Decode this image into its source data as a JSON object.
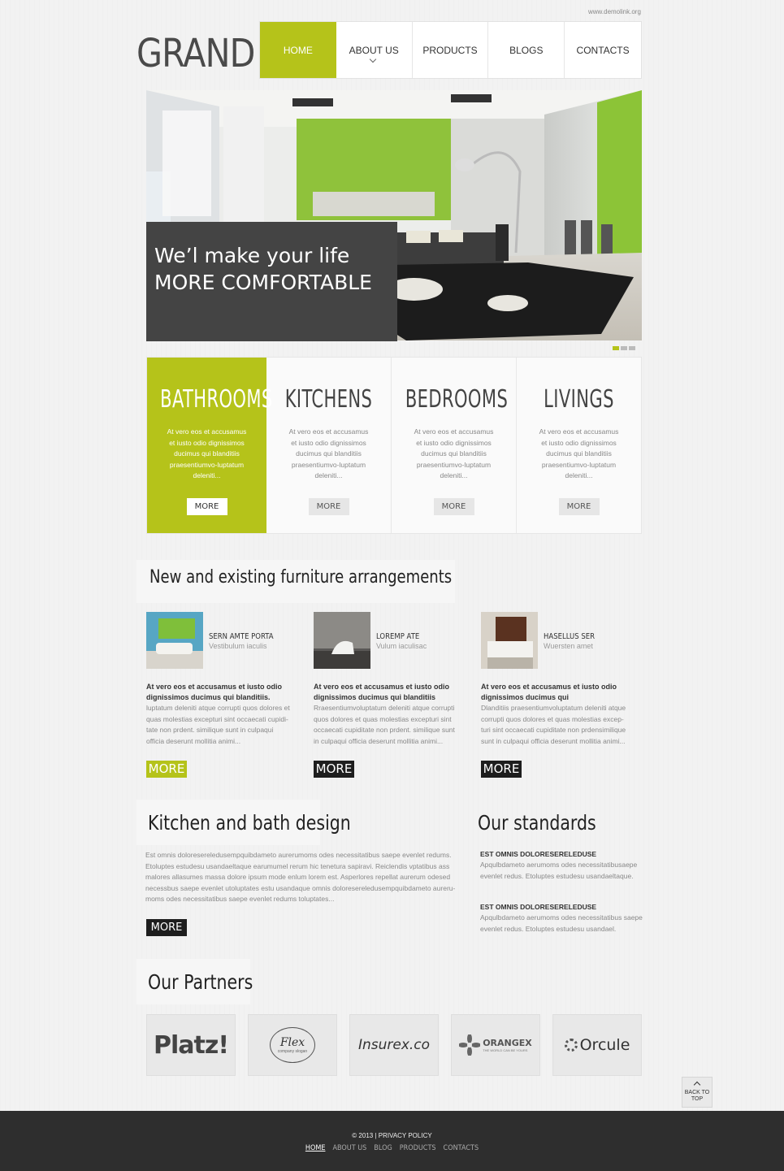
{
  "header": {
    "demo_link": "www.demolink.org",
    "logo": "GRAND",
    "nav": [
      "HOME",
      "ABOUT US",
      "PRODUCTS",
      "BLOGS",
      "CONTACTS"
    ]
  },
  "hero": {
    "line1": "We’l make your life",
    "line2": "MORE COMFORTABLE",
    "slides_total": 3,
    "slide_active": 1
  },
  "categories": [
    {
      "title": "BATHROOMS",
      "text": "At vero eos et accusamus et iusto odio dignissimos ducimus qui blanditiis praesentiumvo-luptatum deleniti...",
      "more": "MORE"
    },
    {
      "title": "KITCHENS",
      "text": "At vero eos et accusamus et iusto odio dignissimos ducimus qui blanditiis praesentiumvo-luptatum deleniti...",
      "more": "MORE"
    },
    {
      "title": "BEDROOMS",
      "text": "At vero eos et accusamus et iusto odio dignissimos ducimus qui blanditiis praesentiumvo-luptatum deleniti...",
      "more": "MORE"
    },
    {
      "title": "LIVINGS",
      "text": "At vero eos et accusamus et iusto odio dignissimos ducimus qui blanditiis praesentiumvo-luptatum deleniti...",
      "more": "MORE"
    }
  ],
  "arrangements": {
    "title": "New and existing furniture arrangements",
    "items": [
      {
        "name": "SERN AMTE PORTA",
        "sub": "Vestibulum iaculis",
        "bold": "At vero eos et accusamus et iusto odio dignissimos ducimus qui blanditiis.",
        "text": "luptatum deleniti atque corrupti quos dolores et quas molestias excepturi sint occaecati cupidi-tate non prdent. similique sunt in culpaqui officia deserunt mollitia animi...",
        "more": "MORE"
      },
      {
        "name": "LOREMP ATE",
        "sub": "Vulum iaculisac",
        "bold": "At vero eos et accusamus et iusto odio dignissimos ducimus qui blanditiis",
        "text": "Rraesentiumvoluptatum deleniti atque corrupti quos dolores et quas molestias excepturi sint occaecati cupiditate non prdent. similique sunt in culpaqui officia deserunt mollitia animi...",
        "more": "MORE"
      },
      {
        "name": "HASELLUS SER",
        "sub": "Wuersten amet",
        "bold": "At vero eos et accusamus et iusto odio dignissimos ducimus qui",
        "text": "Dlanditiis praesentiumvoluptatum deleniti atque corrupti quos dolores et quas molestias excep-turi sint occaecati cupiditate non prdensimilique sunt in culpaqui officia deserunt mollitia animi...",
        "more": "MORE"
      }
    ]
  },
  "kitchen": {
    "title": "Kitchen and bath design",
    "text": "Est omnis doloresereledusempquibdameto aurerumoms odes necessitatibus saepe evenlet redums. Etoluptes estudesu usandaeltaque earumumel rerum hic tenetura sapiravi. Reiclendis vptatibus ass malores allasumes massa dolore ipsum mode enlum lorem est. Asperlores repellat aurerum odesed necessbus saepe evenlet utoluptates estu usandaque omnis doloresereledusempquibdameto aureru-moms odes necessitatibus saepe evenlet redums toluptates...",
    "more": "MORE"
  },
  "standards": {
    "title": "Our standards",
    "items": [
      {
        "head": "EST OMNIS DOLORESERELEDUSE",
        "text": "Apqulbdameto aerumoms odes necessitatibusaepe evenlet redus. Etoluptes estudesu usandaeltaque."
      },
      {
        "head": "EST OMNIS DOLORESERELEDUSE",
        "text": "Apqulbdameto aerumoms odes necessitatibus saepe evenlet redus. Etoluptes estudesu usandael."
      }
    ]
  },
  "partners": {
    "title": "Our Partners",
    "logos": [
      "Platz!",
      "Flex",
      "Insurex.co",
      "ORANGEX",
      "Orcule"
    ],
    "flex_slogan": "company slogan",
    "orangex_slogan": "THE WORLD CAN BE YOURS"
  },
  "back_to_top": {
    "line1": "BACK TO",
    "line2": "TOP"
  },
  "footer": {
    "copyright": "© 2013 | PRIVACY POLICY",
    "nav": [
      "HOME",
      "ABOUT US",
      "BLOG",
      "PRODUCTS",
      "CONTACTS"
    ]
  },
  "colors": {
    "accent": "#b5c31a",
    "dark": "#444444",
    "footer": "#2e2e2e"
  }
}
